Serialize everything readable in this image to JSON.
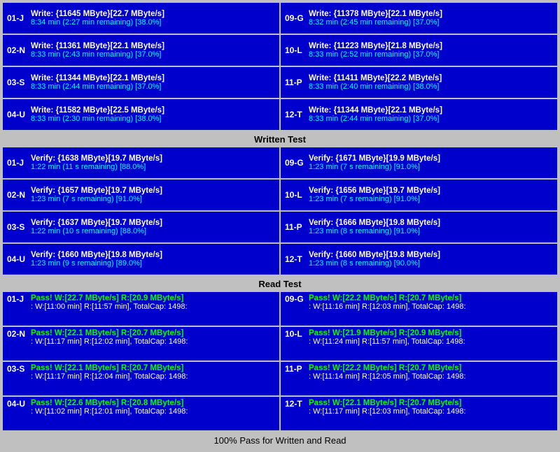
{
  "sections": {
    "written_test": {
      "label": "Written Test",
      "rows": [
        {
          "left": {
            "id": "01-J",
            "line1": "Write: {11645 MByte}[22.7 MByte/s]",
            "line2": "8:34 min (2:27 min remaining)  [38.0%]"
          },
          "right": {
            "id": "09-G",
            "line1": "Write: {11378 MByte}[22.1 MByte/s]",
            "line2": "8:32 min (2:45 min remaining)  [37.0%]"
          }
        },
        {
          "left": {
            "id": "02-N",
            "line1": "Write: {11361 MByte}[22.1 MByte/s]",
            "line2": "8:33 min (2:43 min remaining)  [37.0%]"
          },
          "right": {
            "id": "10-L",
            "line1": "Write: {11223 MByte}[21.8 MByte/s]",
            "line2": "8:33 min (2:52 min remaining)  [37.0%]"
          }
        },
        {
          "left": {
            "id": "03-S",
            "line1": "Write: {11344 MByte}[22.1 MByte/s]",
            "line2": "8:33 min (2:44 min remaining)  [37.0%]"
          },
          "right": {
            "id": "11-P",
            "line1": "Write: {11411 MByte}[22.2 MByte/s]",
            "line2": "8:33 min (2:40 min remaining)  [38.0%]"
          }
        },
        {
          "left": {
            "id": "04-U",
            "line1": "Write: {11582 MByte}[22.5 MByte/s]",
            "line2": "8:33 min (2:30 min remaining)  [38.0%]"
          },
          "right": {
            "id": "12-T",
            "line1": "Write: {11344 MByte}[22.1 MByte/s]",
            "line2": "8:33 min (2:44 min remaining)  [37.0%]"
          }
        }
      ]
    },
    "verify_test": {
      "rows": [
        {
          "left": {
            "id": "01-J",
            "line1": "Verify: {1638 MByte}[19.7 MByte/s]",
            "line2": "1:22 min (11 s remaining)   [88.0%]"
          },
          "right": {
            "id": "09-G",
            "line1": "Verify: {1671 MByte}[19.9 MByte/s]",
            "line2": "1:23 min (7 s remaining)   [91.0%]"
          }
        },
        {
          "left": {
            "id": "02-N",
            "line1": "Verify: {1657 MByte}[19.7 MByte/s]",
            "line2": "1:23 min (7 s remaining)   [91.0%]"
          },
          "right": {
            "id": "10-L",
            "line1": "Verify: {1656 MByte}[19.7 MByte/s]",
            "line2": "1:23 min (7 s remaining)   [91.0%]"
          }
        },
        {
          "left": {
            "id": "03-S",
            "line1": "Verify: {1637 MByte}[19.7 MByte/s]",
            "line2": "1:22 min (10 s remaining)   [88.0%]"
          },
          "right": {
            "id": "11-P",
            "line1": "Verify: {1666 MByte}[19.8 MByte/s]",
            "line2": "1:23 min (8 s remaining)   [91.0%]"
          }
        },
        {
          "left": {
            "id": "04-U",
            "line1": "Verify: {1660 MByte}[19.8 MByte/s]",
            "line2": "1:23 min (9 s remaining)   [89.0%]"
          },
          "right": {
            "id": "12-T",
            "line1": "Verify: {1660 MByte}[19.8 MByte/s]",
            "line2": "1:23 min (8 s remaining)   [90.0%]"
          }
        }
      ]
    },
    "read_test": {
      "label": "Read Test",
      "rows": [
        {
          "left": {
            "id": "01-J",
            "line1": "Pass! W:[22.7 MByte/s] R:[20.9 MByte/s]",
            "line2": ": W:[11:00 min] R:[11:57 min], TotalCap: 1498:"
          },
          "right": {
            "id": "09-G",
            "line1": "Pass! W:[22.2 MByte/s] R:[20.7 MByte/s]",
            "line2": ": W:[11:16 min] R:[12:03 min], TotalCap: 1498:"
          }
        },
        {
          "left": {
            "id": "02-N",
            "line1": "Pass! W:[22.1 MByte/s] R:[20.7 MByte/s]",
            "line2": ": W:[11:17 min] R:[12:02 min], TotalCap: 1498:"
          },
          "right": {
            "id": "10-L",
            "line1": "Pass! W:[21.9 MByte/s] R:[20.9 MByte/s]",
            "line2": ": W:[11:24 min] R:[11:57 min], TotalCap: 1498:"
          }
        },
        {
          "left": {
            "id": "03-S",
            "line1": "Pass! W:[22.1 MByte/s] R:[20.7 MByte/s]",
            "line2": ": W:[11:17 min] R:[12:04 min], TotalCap: 1498:"
          },
          "right": {
            "id": "11-P",
            "line1": "Pass! W:[22.2 MByte/s] R:[20.7 MByte/s]",
            "line2": ": W:[11:14 min] R:[12:05 min], TotalCap: 1498:"
          }
        },
        {
          "left": {
            "id": "04-U",
            "line1": "Pass! W:[22.6 MByte/s] R:[20.8 MByte/s]",
            "line2": ": W:[11:02 min] R:[12:01 min], TotalCap: 1498:"
          },
          "right": {
            "id": "12-T",
            "line1": "Pass! W:[22.1 MByte/s] R:[20.7 MByte/s]",
            "line2": ": W:[11:17 min] R:[12:03 min], TotalCap: 1498:"
          }
        }
      ]
    },
    "footer": {
      "label": "100% Pass for Written and Read"
    }
  }
}
